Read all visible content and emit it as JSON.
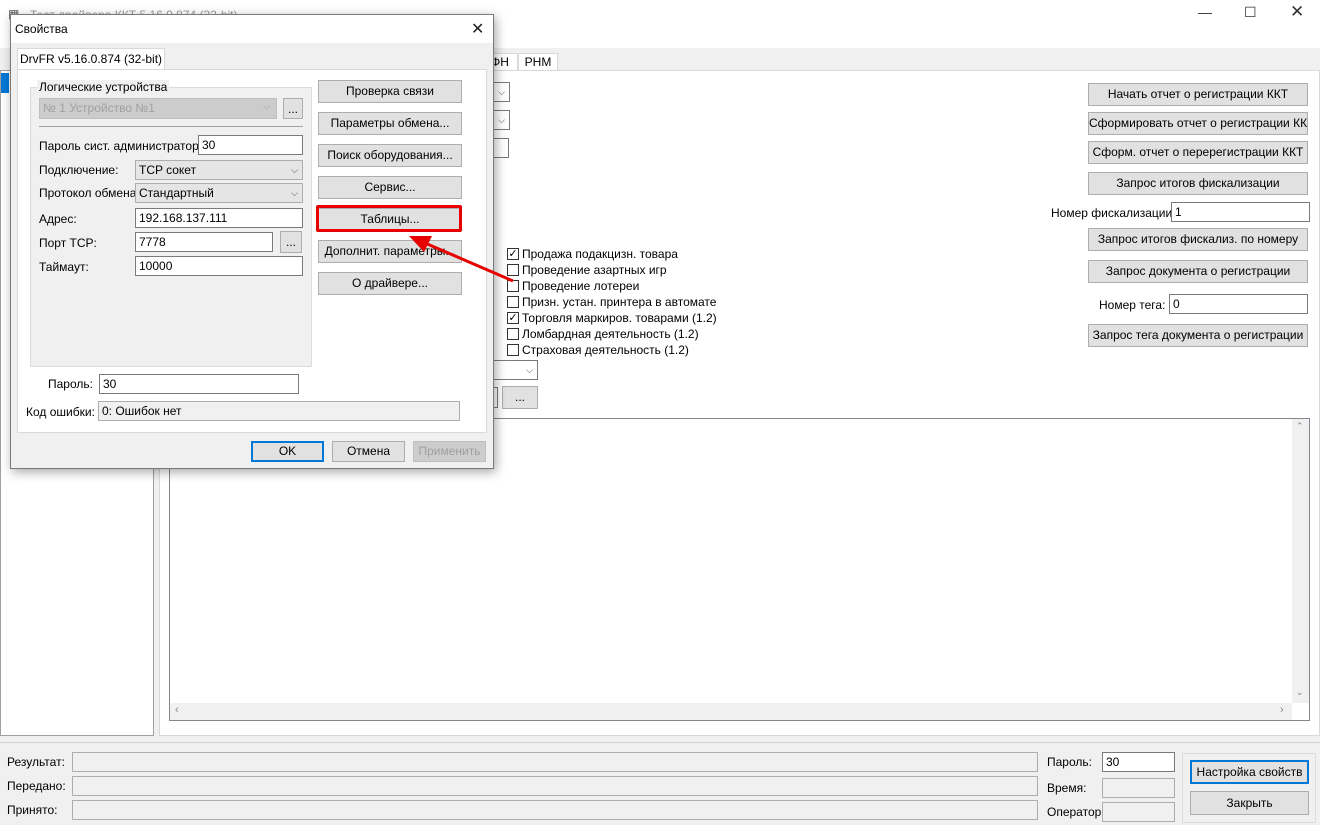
{
  "main_window": {
    "title": "Тест драйвера ККТ 5.16.0.874 (32-bit)",
    "tabs": [
      "ФН",
      "РНМ"
    ],
    "right_buttons": [
      "Начать отчет о регистрации ККТ",
      "Сформировать отчет о регистрации ККТ",
      "Сформ. отчет о перерегистрации ККТ",
      "Запрос итогов фискализации",
      "Запрос итогов фискализ. по номеру",
      "Запрос документа о регистрации",
      "Запрос тега документа о регистрации"
    ],
    "fiscal_number_label": "Номер фискализации:",
    "fiscal_number_value": "1",
    "tag_number_label": "Номер тега:",
    "tag_number_value": "0",
    "checkboxes": [
      {
        "label": "Продажа подакцизн. товара",
        "checked": true
      },
      {
        "label": "Проведение азартных игр",
        "checked": false
      },
      {
        "label": "Проведение лотереи",
        "checked": false
      },
      {
        "label": "Призн. устан. принтера в автомате",
        "checked": false
      },
      {
        "label": "Торговля маркиров. товарами (1.2)",
        "checked": true
      },
      {
        "label": "Ломбардная деятельность (1.2)",
        "checked": false
      },
      {
        "label": "Страховая деятельность (1.2)",
        "checked": false
      }
    ],
    "ellipsis": "...",
    "bottom": {
      "result_label": "Результат:",
      "sent_label": "Передано:",
      "received_label": "Принято:",
      "password_label": "Пароль:",
      "password_value": "30",
      "time_label": "Время:",
      "operator_label": "Оператор:",
      "settings_button": "Настройка свойств",
      "close_button": "Закрыть"
    }
  },
  "dialog": {
    "title": "Свойства",
    "tab": "DrvFR v5.16.0.874 (32-bit)",
    "group_title": "Логические устройства",
    "device": "№ 1 Устройство №1",
    "ellipsis": "...",
    "admin_password_label": "Пароль сист. администратора:",
    "admin_password_value": "30",
    "connection_label": "Подключение:",
    "connection_value": "TCP сокет",
    "protocol_label": "Протокол обмена:",
    "protocol_value": "Стандартный",
    "address_label": "Адрес:",
    "address_value": "192.168.137.111",
    "port_label": "Порт TCP:",
    "port_value": "7778",
    "timeout_label": "Таймаут:",
    "timeout_value": "10000",
    "password_label": "Пароль:",
    "password_value": "30",
    "error_label": "Код ошибки:",
    "error_value": "0: Ошибок нет",
    "buttons": [
      "Проверка связи",
      "Параметры обмена...",
      "Поиск оборудования...",
      "Сервис...",
      "Таблицы...",
      "Дополнит. параметры...",
      "О драйвере..."
    ],
    "ok": "OK",
    "cancel": "Отмена",
    "apply": "Применить"
  },
  "colors": {
    "highlight": "#e60000",
    "focus": "#0078d7"
  }
}
